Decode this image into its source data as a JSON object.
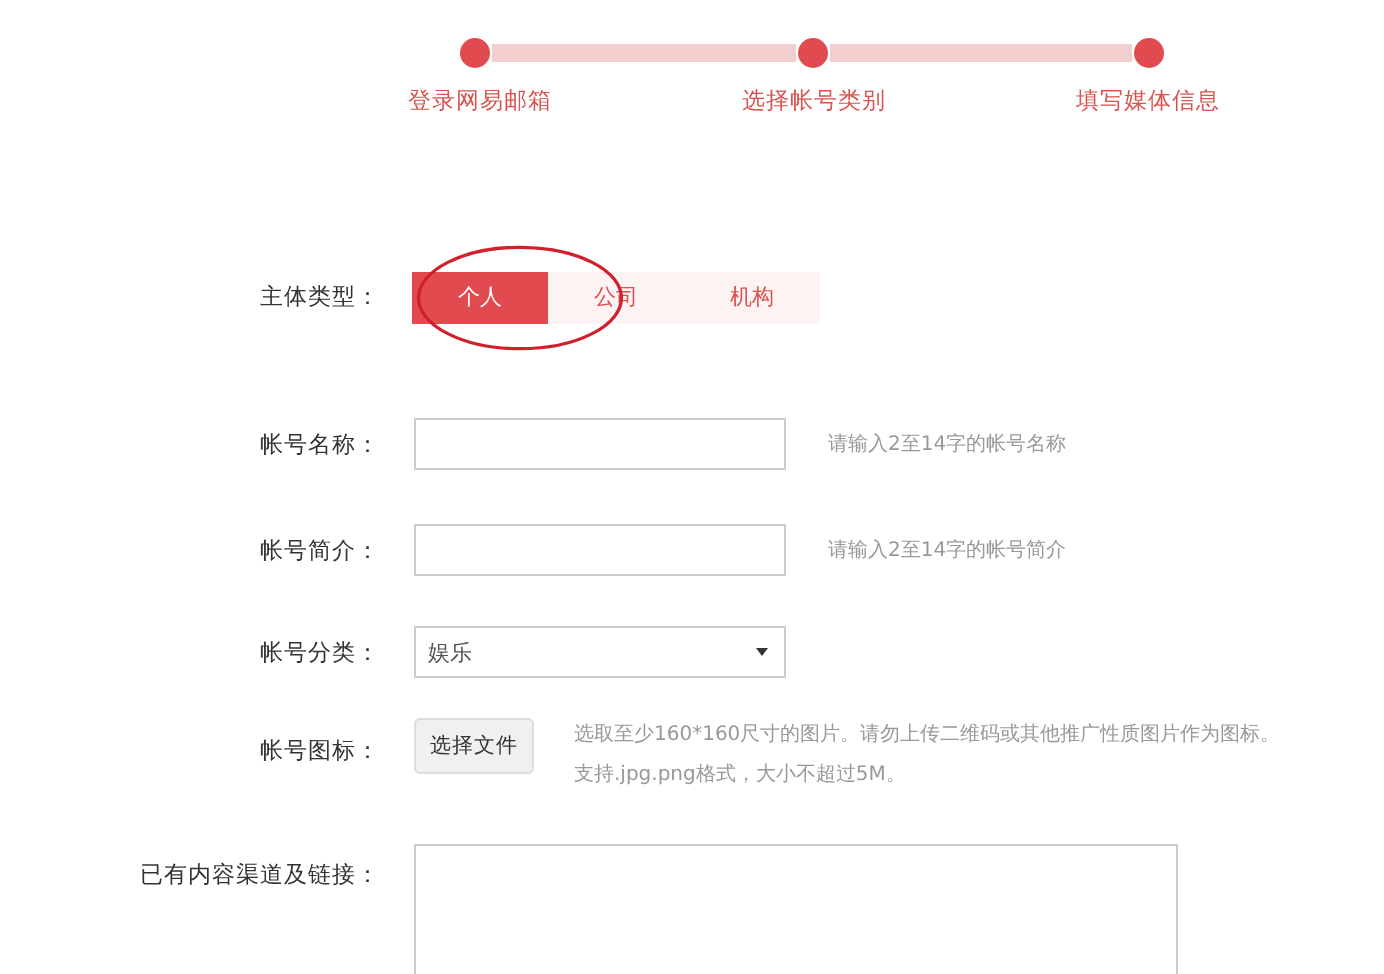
{
  "steps": [
    {
      "label": "登录网易邮箱",
      "done": true
    },
    {
      "label": "选择帐号类别",
      "done": true
    },
    {
      "label": "填写媒体信息",
      "done": true
    }
  ],
  "entity_type": {
    "label": "主体类型：",
    "options": [
      {
        "label": "个人",
        "selected": true
      },
      {
        "label": "公司",
        "selected": false
      },
      {
        "label": "机构",
        "selected": false
      }
    ]
  },
  "fields": [
    {
      "kind": "text",
      "label": "帐号名称：",
      "hint": "请输入2至14字的帐号名称"
    },
    {
      "kind": "text",
      "label": "帐号简介：",
      "hint": "请输入2至14字的帐号简介"
    },
    {
      "kind": "select",
      "label": "帐号分类：",
      "value": "娱乐"
    },
    {
      "kind": "file",
      "label": "帐号图标：",
      "button": "选择文件",
      "hint_lines": [
        "选取至少160*160尺寸的图片。请勿上传二维码或其他推广性质图片作为图标。",
        "支持.jpg.png格式，大小不超过5M。"
      ]
    },
    {
      "kind": "textarea",
      "label": "已有内容渠道及链接："
    }
  ]
}
